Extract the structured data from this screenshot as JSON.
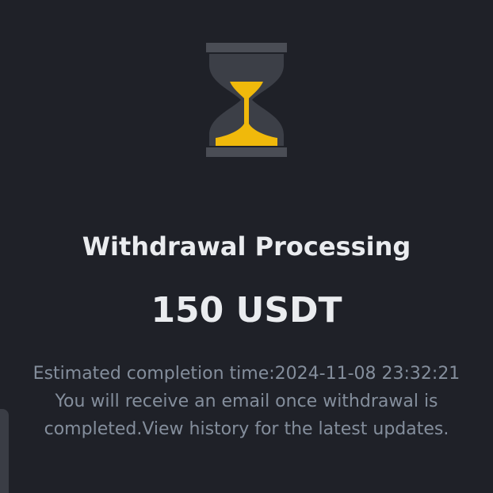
{
  "status": {
    "icon": "hourglass-icon",
    "title": "Withdrawal Processing",
    "amount": "150 USDT"
  },
  "details": {
    "estimated_completion": "Estimated completion time:2024-11-08 23:32:21",
    "email_notice_line1": "You will receive an email once withdrawal is",
    "email_notice_line2": "completed.View history for the latest updates."
  },
  "colors": {
    "background": "#1f2128",
    "accent": "#f0b90b",
    "frame": "#4a4d55",
    "primary_text": "#eaecef",
    "secondary_text": "#848e9c"
  }
}
